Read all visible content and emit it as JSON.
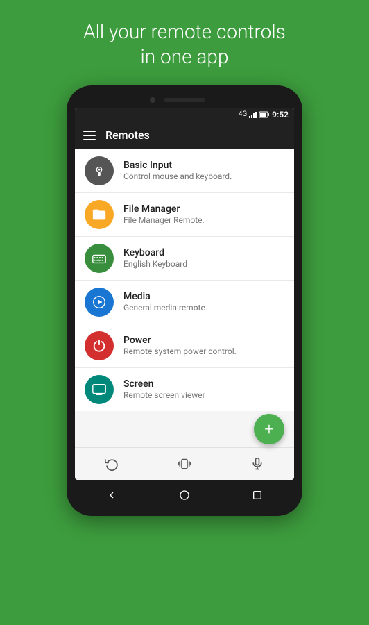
{
  "tagline": {
    "line1": "All your remote controls",
    "line2": "in one app"
  },
  "status_bar": {
    "time": "9:52",
    "signal": "4G"
  },
  "app_bar": {
    "title": "Remotes"
  },
  "list_items": [
    {
      "id": "basic-input",
      "icon_color": "#555555",
      "icon_type": "mouse",
      "title": "Basic Input",
      "subtitle": "Control mouse and keyboard."
    },
    {
      "id": "file-manager",
      "icon_color": "#f9a825",
      "icon_type": "folder",
      "title": "File Manager",
      "subtitle": "File Manager Remote."
    },
    {
      "id": "keyboard",
      "icon_color": "#388e3c",
      "icon_type": "keyboard",
      "title": "Keyboard",
      "subtitle": "English Keyboard"
    },
    {
      "id": "media",
      "icon_color": "#1976d2",
      "icon_type": "play",
      "title": "Media",
      "subtitle": "General media remote."
    },
    {
      "id": "power",
      "icon_color": "#d32f2f",
      "icon_type": "power",
      "title": "Power",
      "subtitle": "Remote system power control."
    },
    {
      "id": "screen",
      "icon_color": "#00897b",
      "icon_type": "screen",
      "title": "Screen",
      "subtitle": "Remote screen viewer"
    }
  ],
  "fab": {
    "label": "+"
  },
  "bottom_nav": {
    "icons": [
      "refresh",
      "vibrate",
      "mic"
    ]
  },
  "system_nav": {
    "back": "◁",
    "home": "○",
    "recents": "□"
  }
}
